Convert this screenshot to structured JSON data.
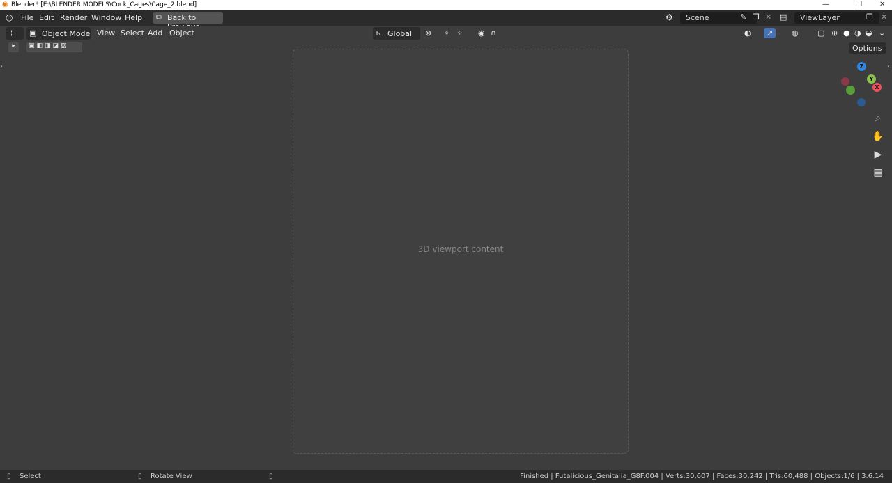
{
  "window": {
    "title": "Blender* [E:\\BLENDER MODELS\\Cock_Cages\\Cage_2.blend]",
    "minimize": "—",
    "maximize": "❐",
    "close": "✕"
  },
  "topbar": {
    "menus": [
      "File",
      "Edit",
      "Render",
      "Window",
      "Help"
    ],
    "back_label": "Back to Previous",
    "scene": "Scene",
    "view_layer": "ViewLayer"
  },
  "viewport_header": {
    "mode": "Object Mode",
    "menus": [
      "View",
      "Select",
      "Add",
      "Object"
    ],
    "transform_orientation": "Global",
    "options_label": "Options"
  },
  "viewport": {
    "placeholder": "3D viewport content"
  },
  "gizmo": {
    "z": "Z",
    "y": "Y",
    "x": "X"
  },
  "statusbar": {
    "left_action": "Select",
    "mid_action": "Rotate View",
    "info": "Finished | Futalicious_Genitalia_G8F.004 | Verts:30,607 | Faces:30,242 | Tris:60,488 | Objects:1/6 | 3.6.14"
  },
  "colors": {
    "accent": "#4772b3",
    "bg": "#3d3d3d",
    "header": "#2b2b2b"
  }
}
